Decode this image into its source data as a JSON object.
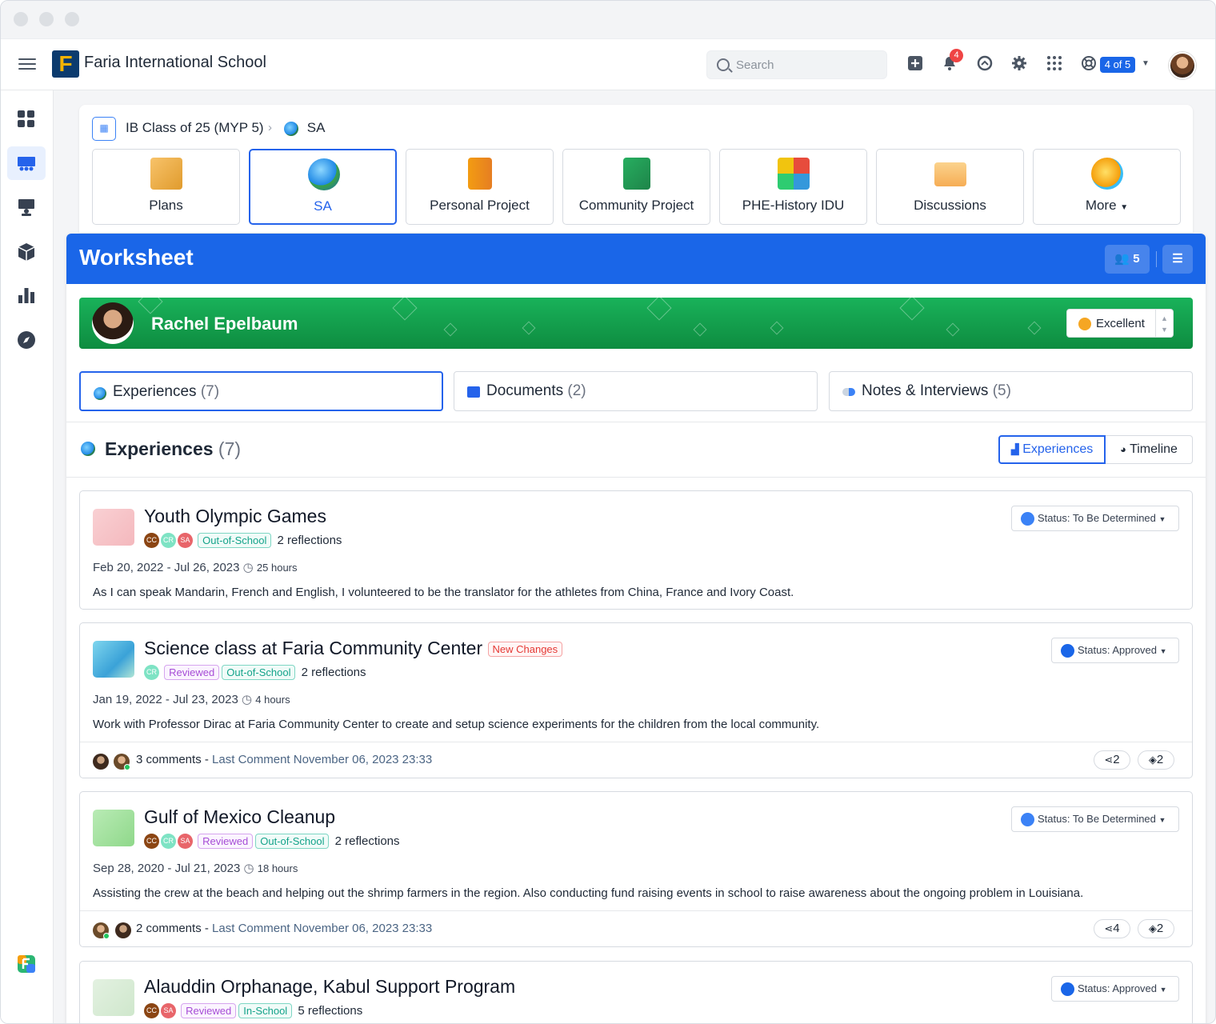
{
  "app": {
    "school_name": "Faria International School",
    "search_placeholder": "Search",
    "notification_count": "4",
    "counter": "4 of 5"
  },
  "sidebar": {
    "items": [
      "dashboard-icon",
      "classes-icon",
      "teaching-icon",
      "units-icon",
      "reports-icon",
      "explore-icon"
    ]
  },
  "breadcrumb": {
    "class": "IB Class of 25 (MYP 5)",
    "current": "SA"
  },
  "tiles": [
    {
      "label": "Plans"
    },
    {
      "label": "SA"
    },
    {
      "label": "Personal Project"
    },
    {
      "label": "Community Project"
    },
    {
      "label": "PHE-History IDU"
    },
    {
      "label": "Discussions"
    },
    {
      "label": "More"
    }
  ],
  "worksheet": {
    "title": "Worksheet",
    "students_count": "5",
    "student_name": "Rachel Epelbaum",
    "grade": "Excellent"
  },
  "tabs": [
    {
      "label": "Experiences",
      "count": "(7)"
    },
    {
      "label": "Documents",
      "count": "(2)"
    },
    {
      "label": "Notes & Interviews",
      "count": "(5)"
    }
  ],
  "section": {
    "title": "Experiences",
    "count": "(7)",
    "view_experiences": "Experiences",
    "view_timeline": "Timeline"
  },
  "experiences": [
    {
      "title": "Youth Olympic Games",
      "new_changes": "",
      "chips": [
        "CC",
        "CR",
        "SA"
      ],
      "pills": [
        {
          "type": "out",
          "label": "Out-of-School"
        }
      ],
      "reflections": "2 reflections",
      "dates": "Feb 20, 2022 - Jul 26, 2023",
      "hours": "25 hours",
      "description": "As I can speak Mandarin, French and English, I volunteered to be the translator for the athletes from China, France and Ivory Coast.",
      "status": "Status: To Be Determined",
      "comments": "",
      "last_comment": "",
      "share_count": "",
      "layer_count": ""
    },
    {
      "title": "Science class at Faria Community Center",
      "new_changes": "New Changes",
      "chips": [
        "CR"
      ],
      "pills": [
        {
          "type": "rev",
          "label": "Reviewed"
        },
        {
          "type": "out",
          "label": "Out-of-School"
        }
      ],
      "reflections": "2 reflections",
      "dates": "Jan 19, 2022 - Jul 23, 2023",
      "hours": "4 hours",
      "description": "Work with Professor Dirac at Faria Community Center to create and setup science experiments for the children from the local community.",
      "status": "Status: Approved",
      "comments": "3 comments",
      "last_comment": "Last Comment November 06, 2023 23:33",
      "share_count": "2",
      "layer_count": "2"
    },
    {
      "title": "Gulf of Mexico Cleanup",
      "new_changes": "",
      "chips": [
        "CC",
        "CR",
        "SA"
      ],
      "pills": [
        {
          "type": "rev",
          "label": "Reviewed"
        },
        {
          "type": "out",
          "label": "Out-of-School"
        }
      ],
      "reflections": "2 reflections",
      "dates": "Sep 28, 2020 - Jul 21, 2023",
      "hours": "18 hours",
      "description": "Assisting the crew at the beach and helping out the shrimp farmers in the region. Also conducting fund raising events in school to raise awareness about the ongoing problem in Louisiana.",
      "status": "Status: To Be Determined",
      "comments": "2 comments",
      "last_comment": "Last Comment November 06, 2023 23:33",
      "share_count": "4",
      "layer_count": "2"
    },
    {
      "title": "Alauddin Orphanage, Kabul Support Program",
      "new_changes": "",
      "chips": [
        "CC",
        "SA"
      ],
      "pills": [
        {
          "type": "rev",
          "label": "Reviewed"
        },
        {
          "type": "out",
          "label": "In-School"
        }
      ],
      "reflections": "5 reflections",
      "dates": "",
      "hours": "",
      "description": "",
      "status": "Status: Approved",
      "comments": "",
      "last_comment": "",
      "share_count": "",
      "layer_count": ""
    }
  ]
}
